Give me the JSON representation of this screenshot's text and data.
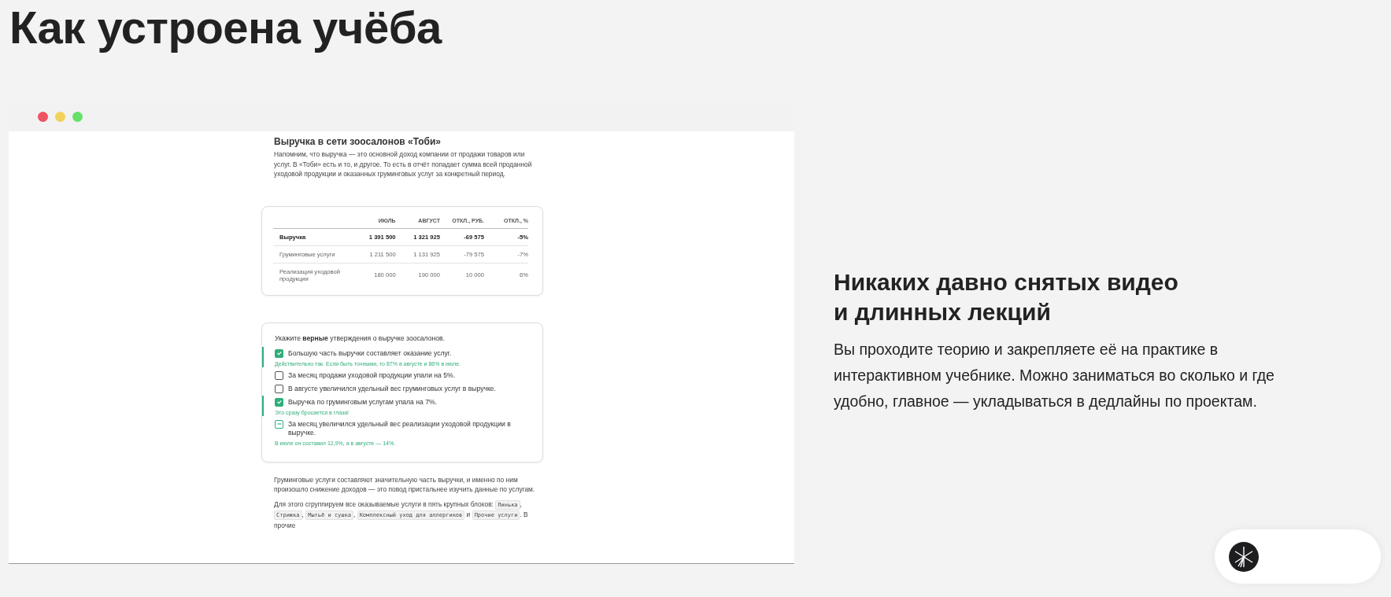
{
  "page_title": "Как устроена учёба",
  "lesson": {
    "heading": "Выручка в сети зоосалонов «Тоби»",
    "intro": "Напомним, что выручка — это основной доход компании от продажи товаров или услуг. В «Тоби» есть и то, и другое. То есть в отчёт попадает сумма всей проданной уходовой продукции и оказанных груминговых услуг за конкретный период.",
    "table": {
      "columns": [
        "",
        "ИЮЛЬ",
        "АВГУСТ",
        "ОТКЛ., РУБ.",
        "ОТКЛ., %"
      ],
      "rows": [
        {
          "emphasis": true,
          "cells": [
            "Выручка",
            "1 391 500",
            "1 321 925",
            "-69 575",
            "-5%"
          ]
        },
        {
          "emphasis": false,
          "cells": [
            "Груминговые услуги",
            "1 211 500",
            "1 131 925",
            "-79 575",
            "-7%"
          ]
        },
        {
          "emphasis": false,
          "cells": [
            "Реализация уходовой продукции",
            "180 000",
            "190 000",
            "10 000",
            "6%"
          ]
        }
      ]
    },
    "quiz": {
      "question": "Укажите **верные** утверждения о выручке зоосалонов.",
      "options": [
        {
          "text": "Большую часть выручки составляет оказание услуг.",
          "checked": true,
          "indeterminate": false,
          "feedback": "Действительно так. Если быть точными, то 87% в августе и 86% в июле."
        },
        {
          "text": "За месяц продажи уходовой продукции упали на 5%.",
          "checked": false,
          "indeterminate": false
        },
        {
          "text": "В августе увеличился удельный вес груминговых услуг в выручке.",
          "checked": false,
          "indeterminate": false
        },
        {
          "text": "Выручка по груминговым услугам упала на 7%.",
          "checked": true,
          "indeterminate": false,
          "feedback": "Это сразу бросается в глаза!"
        },
        {
          "text": "За месяц увеличился удельный вес реализации уходовой продукции в выручке.",
          "checked": false,
          "indeterminate": true,
          "feedback": "В июле он составил 12,9%, а в августе — 14%."
        }
      ]
    },
    "outro": "Груминговые услуги составляют значительную часть выручки, и именно по ним произошло снижение доходов — это повод пристальнее изучить данные по услугам.",
    "groups_paragraph": [
      {
        "kind": "text",
        "text": "Для этого сгруппируем все оказываемые услуги в пять крупных блоков: "
      },
      {
        "kind": "code",
        "text": "Линька"
      },
      {
        "kind": "text",
        "text": ", "
      },
      {
        "kind": "code",
        "text": "Стрижка"
      },
      {
        "kind": "text",
        "text": ", "
      },
      {
        "kind": "code",
        "text": "Мытьё и сушка"
      },
      {
        "kind": "text",
        "text": ", "
      },
      {
        "kind": "code",
        "text": "Комплексный уход для аллергиков"
      },
      {
        "kind": "text",
        "text": " и "
      },
      {
        "kind": "code",
        "text": "Прочие услуги"
      },
      {
        "kind": "text",
        "text": ". В прочие"
      }
    ]
  },
  "feature": {
    "heading": "Никаких давно снятых видео и длинных лекций",
    "body": "Вы проходите теорию и закрепляете её на практике в интерактивном учебнике. Можно заниматься во сколько и где удобно, главное — укладываться в дедлайны по проектам."
  }
}
